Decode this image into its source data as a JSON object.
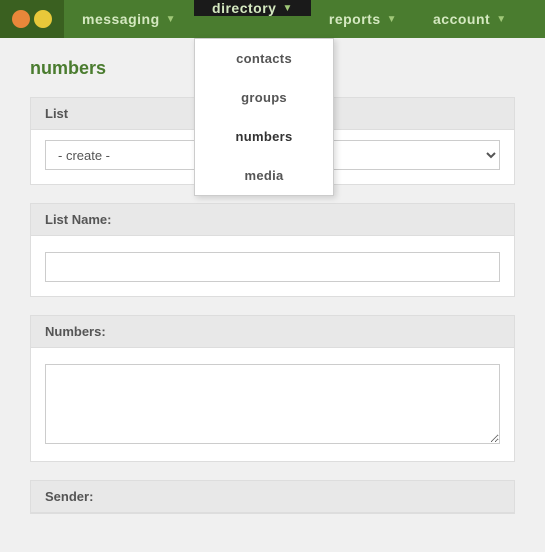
{
  "nav": {
    "logo_alt": "Logo",
    "items": [
      {
        "id": "messaging",
        "label": "messaging",
        "has_caret": true,
        "active": false
      },
      {
        "id": "directory",
        "label": "directory",
        "has_caret": true,
        "active": true
      },
      {
        "id": "reports",
        "label": "reports",
        "has_caret": true,
        "active": false
      },
      {
        "id": "account",
        "label": "account",
        "has_caret": true,
        "active": false
      }
    ],
    "dropdown": {
      "items": [
        {
          "id": "contacts",
          "label": "contacts"
        },
        {
          "id": "groups",
          "label": "groups"
        },
        {
          "id": "numbers",
          "label": "numbers",
          "active": true
        },
        {
          "id": "media",
          "label": "media"
        }
      ]
    }
  },
  "page": {
    "title": "numbers",
    "sections": {
      "list": {
        "header": "List",
        "select_default": "- create -"
      },
      "list_name": {
        "header": "List Name:"
      },
      "numbers": {
        "header": "Numbers:"
      },
      "sender": {
        "header": "Sender:"
      }
    }
  }
}
